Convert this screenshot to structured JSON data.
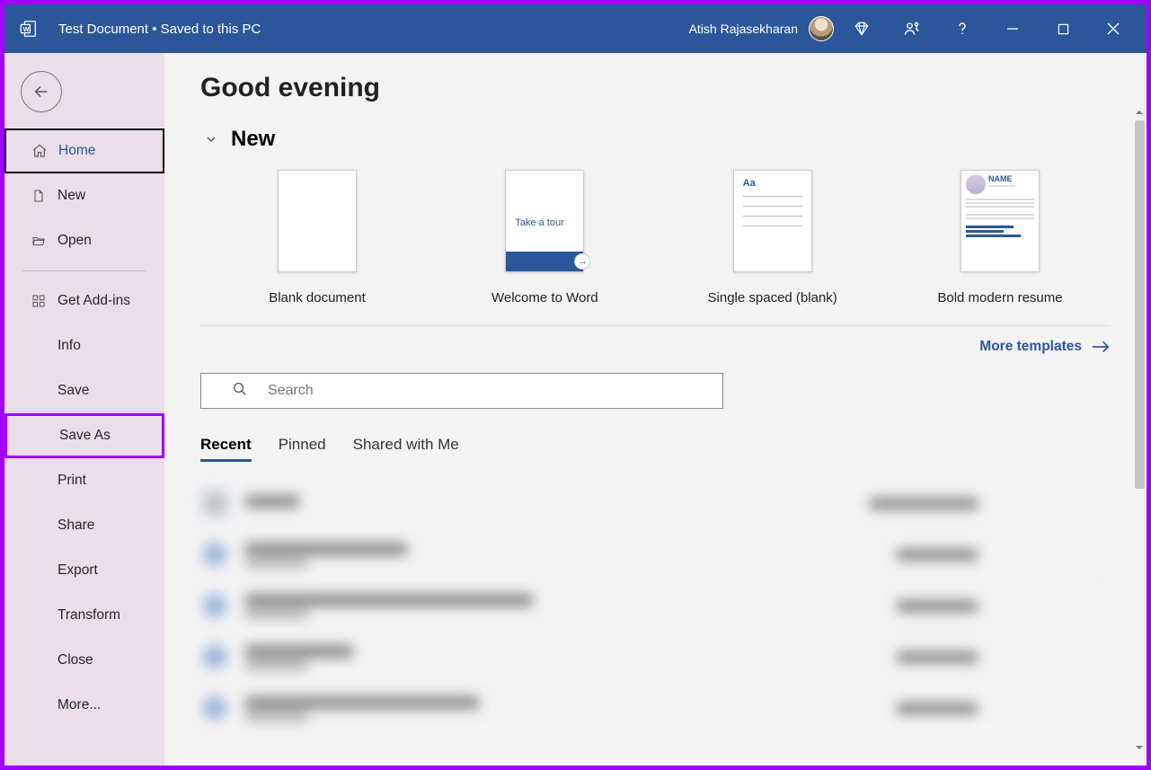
{
  "titlebar": {
    "document_title": "Test Document • Saved to this PC",
    "username": "Atish Rajasekharan"
  },
  "sidebar": {
    "items": [
      {
        "label": "Home"
      },
      {
        "label": "New"
      },
      {
        "label": "Open"
      },
      {
        "label": "Get Add-ins"
      },
      {
        "label": "Info"
      },
      {
        "label": "Save"
      },
      {
        "label": "Save As"
      },
      {
        "label": "Print"
      },
      {
        "label": "Share"
      },
      {
        "label": "Export"
      },
      {
        "label": "Transform"
      },
      {
        "label": "Close"
      },
      {
        "label": "More..."
      }
    ]
  },
  "main": {
    "greeting": "Good evening",
    "section_new": "New",
    "templates": [
      {
        "label": "Blank document"
      },
      {
        "label": "Welcome to Word",
        "tour_text": "Take a tour"
      },
      {
        "label": "Single spaced (blank)",
        "aa": "Aa"
      },
      {
        "label": "Bold modern resume",
        "rname": "NAME"
      }
    ],
    "more_templates": "More templates",
    "search_placeholder": "Search",
    "tabs": [
      {
        "label": "Recent"
      },
      {
        "label": "Pinned"
      },
      {
        "label": "Shared with Me"
      }
    ]
  }
}
